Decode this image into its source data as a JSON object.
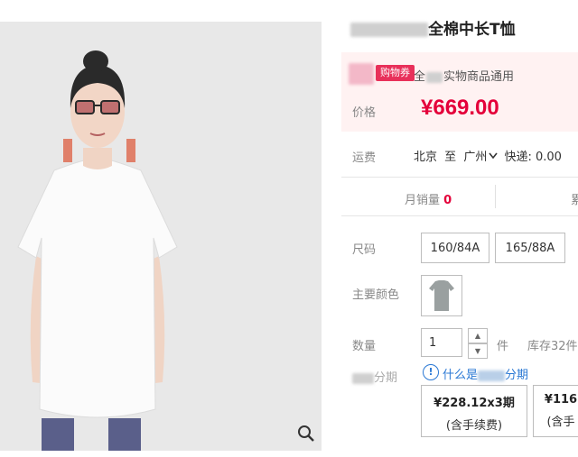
{
  "product": {
    "title_visible": "全棉中长T恤",
    "coupon_tag": "购物券",
    "coupon_text_start": "全",
    "coupon_text_end": "实物商品通用",
    "price_label": "价格",
    "price": "¥669.00"
  },
  "shipping": {
    "label": "运费",
    "from": "北京",
    "to_word": "至",
    "to": "广州",
    "express": "快递: 0.00"
  },
  "sales": {
    "label": "月销量",
    "count": "0",
    "more": "累"
  },
  "options": {
    "size_label": "尺码",
    "sizes": [
      "160/84A",
      "165/88A"
    ],
    "color_label": "主要颜色",
    "quantity_label": "数量",
    "quantity_value": "1",
    "unit": "件",
    "stock": "库存32件"
  },
  "installment": {
    "label_end": "分期",
    "info_text_start": "什么是",
    "info_text_end": "分期",
    "plans": [
      {
        "amount": "¥228.12x3期",
        "fee": "(含手续费)"
      },
      {
        "amount": "¥116",
        "fee": "(含手"
      }
    ]
  },
  "icons": {
    "zoom": "magnifier-icon",
    "info": "info-icon",
    "chevron": "chevron-down-icon"
  },
  "colors": {
    "accent": "#e4003a",
    "coupon_bg": "#e8305a",
    "link": "#2a78d4"
  }
}
